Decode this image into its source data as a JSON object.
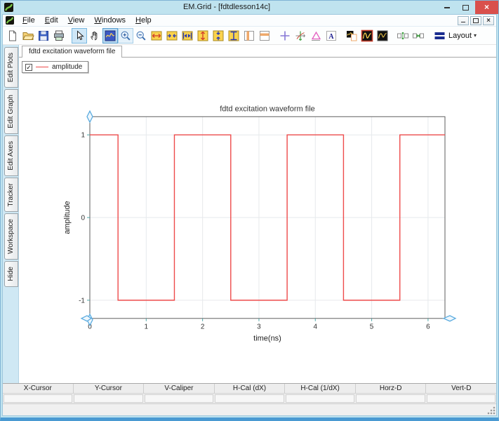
{
  "window": {
    "title": "EM.Grid - [fdtdlesson14c]",
    "controls": [
      "minimize",
      "maximize",
      "close"
    ]
  },
  "menu": {
    "items": [
      {
        "label": "File",
        "underline": 0
      },
      {
        "label": "Edit",
        "underline": 0
      },
      {
        "label": "View",
        "underline": 0
      },
      {
        "label": "Windows",
        "underline": 0
      },
      {
        "label": "Help",
        "underline": 0
      }
    ],
    "mdi_controls": [
      "minimize",
      "restore",
      "close"
    ]
  },
  "toolbar": {
    "items": [
      {
        "name": "new-file"
      },
      {
        "name": "open-file"
      },
      {
        "name": "save"
      },
      {
        "name": "print"
      },
      {
        "sep": true
      },
      {
        "name": "select-cursor",
        "state": "selected"
      },
      {
        "name": "pan-hand"
      },
      {
        "name": "zoom-box",
        "state": "pressed"
      },
      {
        "name": "zoom-in",
        "state": "hover"
      },
      {
        "name": "zoom-out"
      },
      {
        "name": "expand-x"
      },
      {
        "name": "shrink-x"
      },
      {
        "name": "fit-x"
      },
      {
        "name": "expand-y"
      },
      {
        "name": "shrink-y"
      },
      {
        "name": "fit-y"
      },
      {
        "name": "vertical-band"
      },
      {
        "name": "horizontal-band"
      },
      {
        "sep": true
      },
      {
        "name": "crosshair"
      },
      {
        "name": "tracker"
      },
      {
        "name": "caliper"
      },
      {
        "name": "add-text"
      },
      {
        "sep": true
      },
      {
        "name": "copy-plot"
      },
      {
        "name": "plot-style-1"
      },
      {
        "name": "plot-style-2"
      },
      {
        "sep": true
      },
      {
        "name": "split-vertical"
      },
      {
        "name": "split-horizontal"
      },
      {
        "sep": true
      },
      {
        "name": "layout",
        "label": "Layout",
        "dropdown": true
      }
    ]
  },
  "side_tabs": [
    "Edit Plots",
    "Edit Graph",
    "Edit Axes",
    "Tracker",
    "Workspace",
    "Hide"
  ],
  "document": {
    "tab_label": "fdtd excitation waveform file"
  },
  "legend": {
    "checked": true,
    "label": "amplitude",
    "line_color": "#ee4b4b"
  },
  "chart_data": {
    "type": "line",
    "title": "fdtd excitation waveform file",
    "xlabel": "time(ns)",
    "ylabel": "amplitude",
    "xlim": [
      0,
      6.3
    ],
    "ylim": [
      -1.22,
      1.22
    ],
    "xticks": [
      0,
      1,
      2,
      3,
      4,
      5,
      6
    ],
    "yticks": [
      -1,
      0,
      1
    ],
    "grid": true,
    "legend_position": "top-left-floating",
    "series": [
      {
        "name": "amplitude",
        "color": "#ee4b4b",
        "points": [
          [
            0,
            1
          ],
          [
            0.5,
            1
          ],
          [
            0.5,
            -1
          ],
          [
            1.5,
            -1
          ],
          [
            1.5,
            1
          ],
          [
            2.5,
            1
          ],
          [
            2.5,
            -1
          ],
          [
            3.5,
            -1
          ],
          [
            3.5,
            1
          ],
          [
            4.5,
            1
          ],
          [
            4.5,
            -1
          ],
          [
            5.5,
            -1
          ],
          [
            5.5,
            1
          ],
          [
            6.3,
            1
          ]
        ]
      }
    ]
  },
  "cursor_table": {
    "headers": [
      "X-Cursor",
      "Y-Cursor",
      "V-Caliper",
      "H-Cal (dX)",
      "H-Cal (1/dX)",
      "Horz-D",
      "Vert-D"
    ],
    "values": [
      "",
      "",
      "",
      "",
      "",
      "",
      ""
    ]
  },
  "colors": {
    "titlebar": "#bfe3ef",
    "window_border_bottom": "#4a9ad2",
    "close_button_red": "#d9504c",
    "waveform_red": "#ee4b4b",
    "handle_cyan": "#5aabdf",
    "tick_teal": "#4aa6a6",
    "selection_blue": "#cfe7f7",
    "grid_gray": "#e6e9ec"
  }
}
